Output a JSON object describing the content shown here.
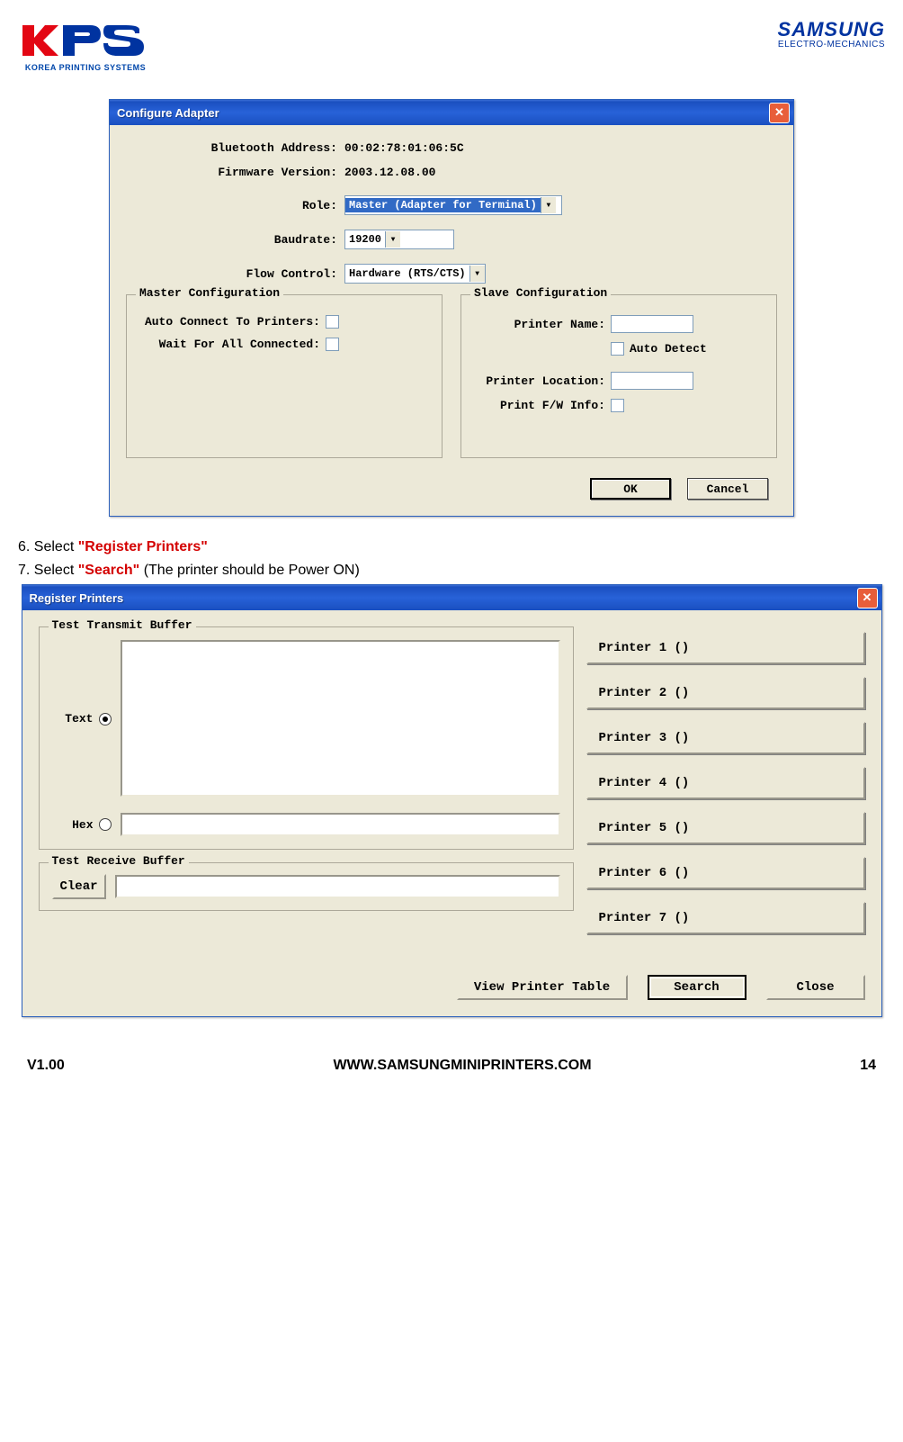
{
  "header": {
    "kps_tag": "KOREA PRINTING SYSTEMS",
    "samsung_word": "SAMSUNG",
    "samsung_sub": "ELECTRO-MECHANICS"
  },
  "dialog1": {
    "title": "Configure Adapter",
    "labels": {
      "bt_addr": "Bluetooth Address:",
      "fw_ver": "Firmware Version:",
      "role": "Role:",
      "baud": "Baudrate:",
      "flow": "Flow Control:"
    },
    "values": {
      "bt_addr": "00:02:78:01:06:5C",
      "fw_ver": "2003.12.08.00",
      "role": "Master (Adapter for Terminal)",
      "baud": "19200",
      "flow": "Hardware (RTS/CTS)"
    },
    "master": {
      "legend": "Master Configuration",
      "auto_connect": "Auto Connect To Printers:",
      "wait_all": "Wait For All Connected:"
    },
    "slave": {
      "legend": "Slave Configuration",
      "printer_name": "Printer Name:",
      "auto_detect": "Auto Detect",
      "printer_loc": "Printer Location:",
      "print_fw": "Print F/W Info:"
    },
    "buttons": {
      "ok": "OK",
      "cancel": "Cancel"
    }
  },
  "instructions": {
    "step6_prefix": "6. Select ",
    "step6_red": "\"Register Printers\"",
    "step7_prefix": "7. Select ",
    "step7_red": "\"Search\"",
    "step7_suffix": " (The printer should be Power ON)"
  },
  "dialog2": {
    "title": "Register Printers",
    "tx_legend": "Test Transmit Buffer",
    "text_label": "Text",
    "hex_label": "Hex",
    "rx_legend": "Test Receive Buffer",
    "clear": "Clear",
    "printers": [
      "Printer 1 ()",
      "Printer 2 ()",
      "Printer 3 ()",
      "Printer 4 ()",
      "Printer 5 ()",
      "Printer 6 ()",
      "Printer 7 ()"
    ],
    "buttons": {
      "view": "View Printer Table",
      "search": "Search",
      "close": "Close"
    }
  },
  "footer": {
    "version": "V1.00",
    "url": "WWW.SAMSUNGMINIPRINTERS.COM",
    "page": "14"
  }
}
